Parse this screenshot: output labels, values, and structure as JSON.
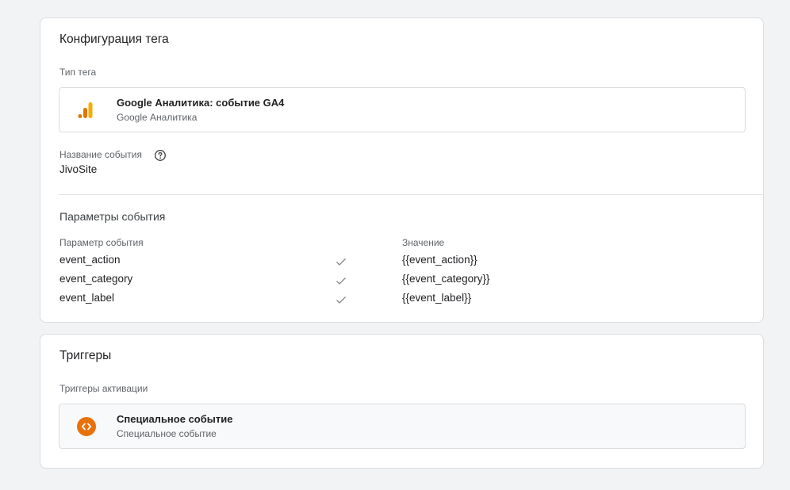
{
  "config": {
    "title": "Конфигурация тега",
    "tag_type_label": "Тип тега",
    "tag_type": {
      "title": "Google Аналитика: событие GA4",
      "subtitle": "Google Аналитика",
      "icon": "google-analytics-icon"
    },
    "event_name_label": "Название события",
    "event_name_value": "JivoSite",
    "params_title": "Параметры события",
    "params_header": {
      "name": "Параметр события",
      "value": "Значение"
    },
    "params": [
      {
        "name": "event_action",
        "value": "{{event_action}}"
      },
      {
        "name": "event_category",
        "value": "{{event_category}}"
      },
      {
        "name": "event_label",
        "value": "{{event_label}}"
      }
    ]
  },
  "triggers": {
    "title": "Триггеры",
    "activation_label": "Триггеры активации",
    "items": [
      {
        "title": "Специальное событие",
        "subtitle": "Специальное событие",
        "icon": "custom-event-icon",
        "icon_color": "#e8710a"
      }
    ]
  },
  "colors": {
    "ga_orange": "#f9ab00",
    "ga_dark_orange": "#e37400",
    "trigger_orange": "#e8710a"
  }
}
